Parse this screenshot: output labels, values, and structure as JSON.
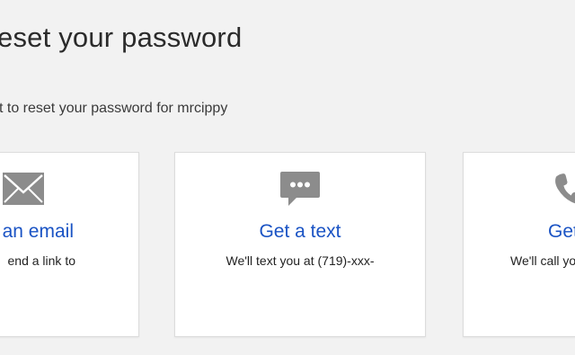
{
  "header": {
    "title": "eset your password",
    "subtitle": "t to reset your password for mrcippy"
  },
  "options": [
    {
      "id": "email",
      "title": "an email",
      "description": "end a link to",
      "icon": "envelope-icon"
    },
    {
      "id": "text",
      "title": "Get a text",
      "description": "We'll text you at (719)-xxx-",
      "icon": "chat-bubble-icon"
    },
    {
      "id": "call",
      "title": "Get",
      "description": "We'll call you",
      "icon": "phone-icon"
    }
  ],
  "colors": {
    "background": "#f2f2f2",
    "card": "#ffffff",
    "link_blue": "#1a53c4",
    "icon_gray": "#8c8c8c",
    "text_dark": "#2b2b2b"
  }
}
